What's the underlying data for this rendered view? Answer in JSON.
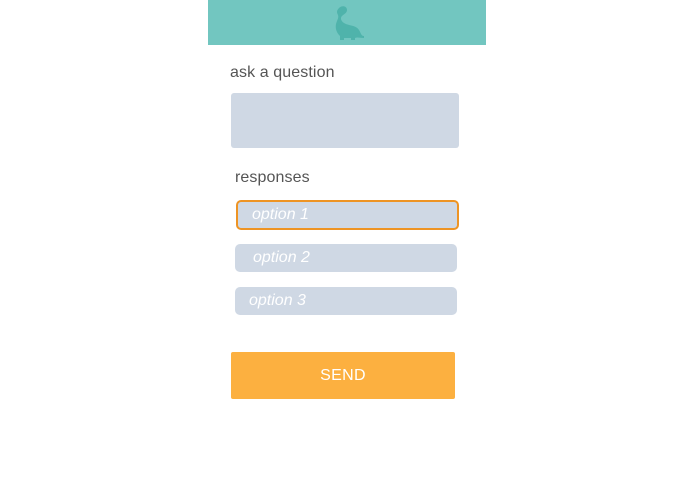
{
  "colors": {
    "header_bg": "#72c6c0",
    "logo": "#4fb3ab",
    "field_bg": "#cfd8e4",
    "focus_border": "#ee9424",
    "send_bg": "#fcb040"
  },
  "header": {
    "logo_icon": "dinosaur-icon"
  },
  "question": {
    "label": "ask a question",
    "value": ""
  },
  "responses": {
    "label": "responses",
    "options": [
      {
        "placeholder": "option 1",
        "focused": true
      },
      {
        "placeholder": "option 2",
        "focused": false
      },
      {
        "placeholder": "option 3",
        "focused": false
      }
    ]
  },
  "send": {
    "label": "SEND"
  }
}
